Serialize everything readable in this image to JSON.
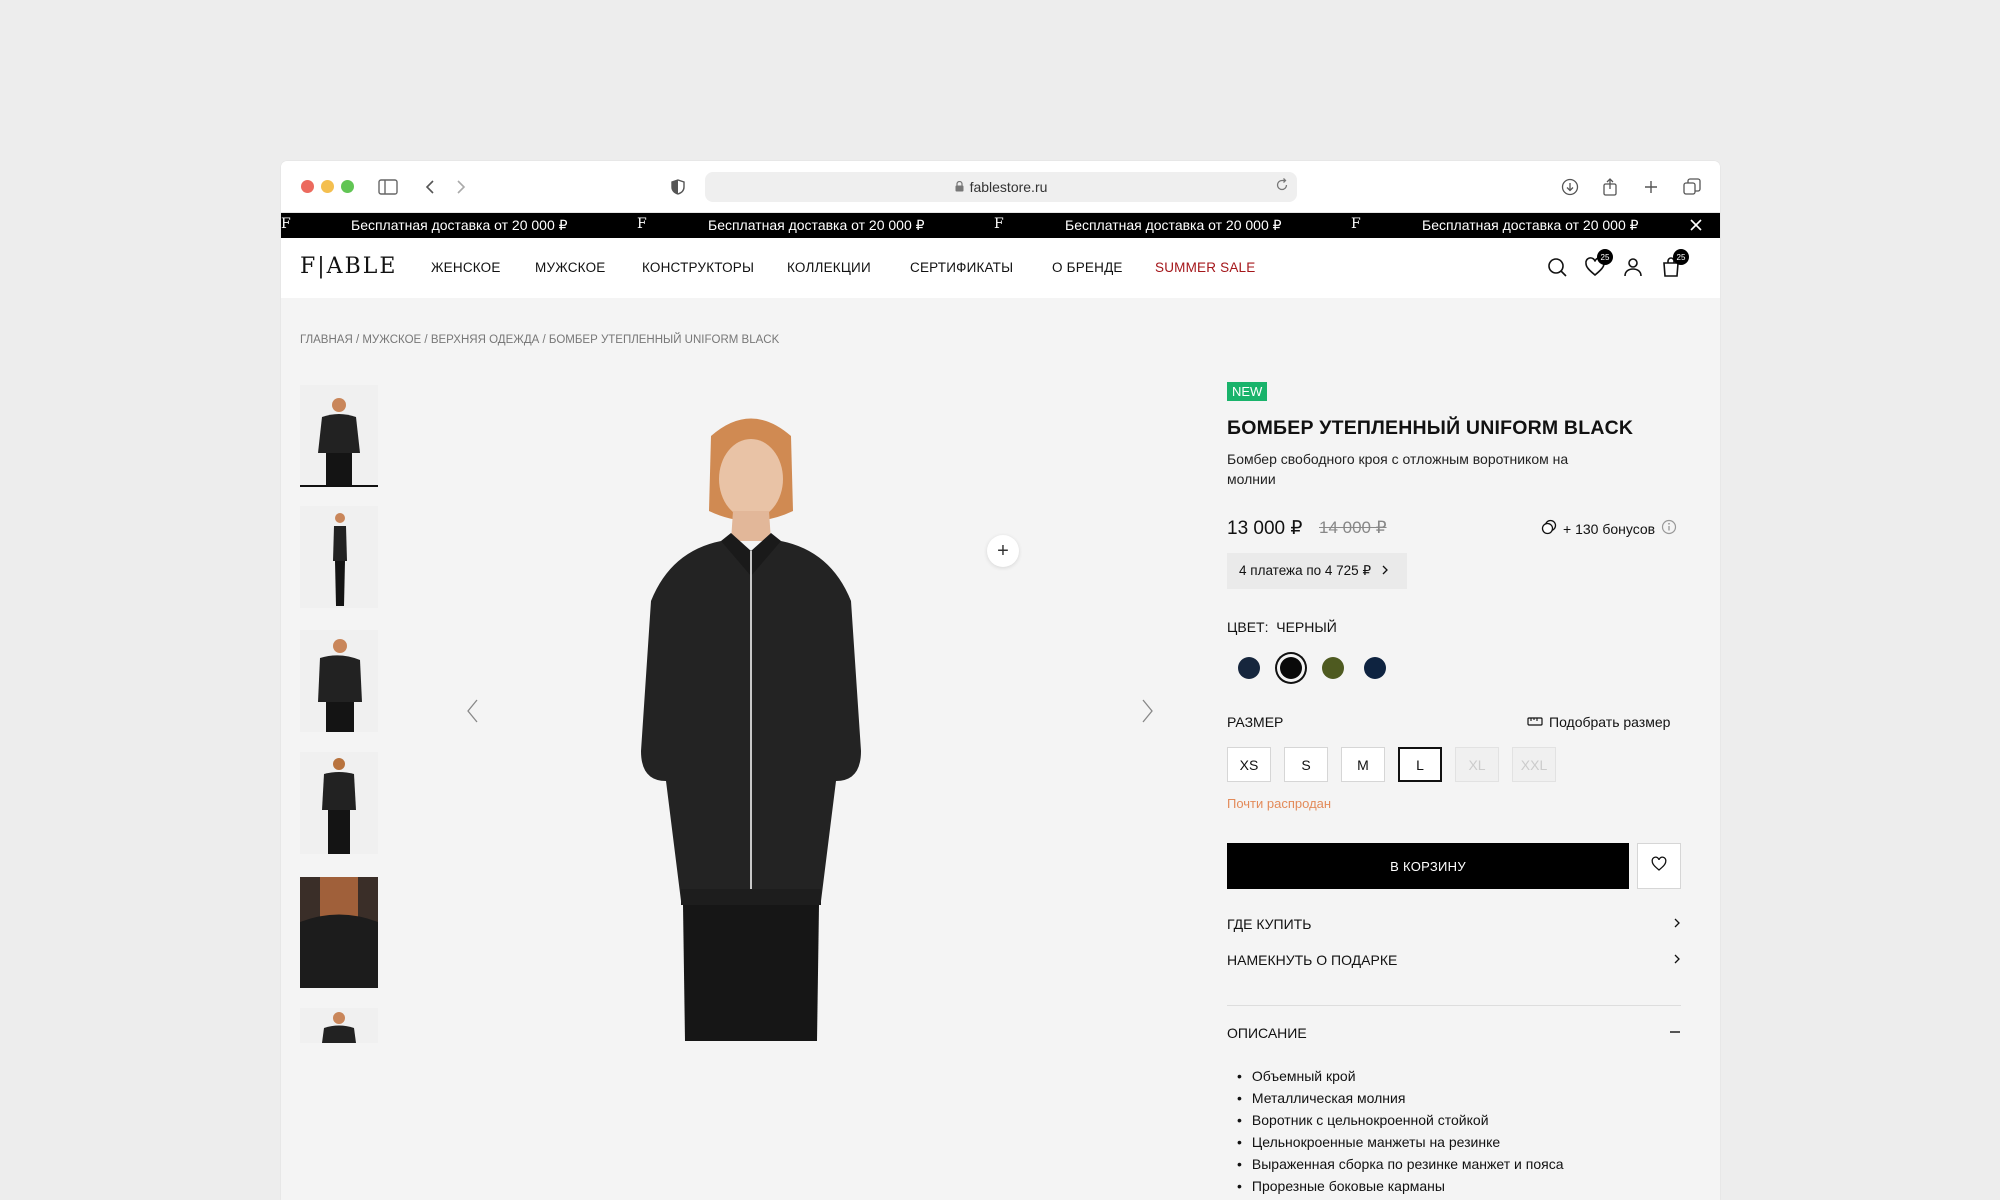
{
  "browser": {
    "url": "fablestore.ru"
  },
  "promo": {
    "brand_mark": "F",
    "text": "Бесплатная доставка от 20 000 ₽"
  },
  "header": {
    "logo": "F|ABLE",
    "nav": [
      "ЖЕНСКОЕ",
      "МУЖСКОЕ",
      "КОНСТРУКТОРЫ",
      "КОЛЛЕКЦИИ",
      "СЕРТИФИКАТЫ",
      "О БРЕНДЕ",
      "SUMMER SALE"
    ],
    "wishlist_count": "25",
    "cart_count": "25"
  },
  "breadcrumbs": [
    "ГЛАВНАЯ",
    "МУЖСКОЕ",
    "ВЕРХНЯЯ ОДЕЖДА",
    "БОМБЕР УТЕПЛЕННЫЙ UNIFORM BLACK"
  ],
  "product": {
    "badge": "NEW",
    "title": "БОМБЕР УТЕПЛЕННЫЙ UNIFORM BLACK",
    "subtitle": "Бомбер свободного кроя с отложным воротником на молнии",
    "price": "13 000 ₽",
    "old_price": "14 000 ₽",
    "bonus": "+ 130 бонусов",
    "installments": "4 платежа по 4 725 ₽",
    "color_label": "ЦВЕТ:",
    "color_value": "ЧЕРНЫЙ",
    "swatches": [
      "#16263d",
      "#0a0a0a",
      "#4e5a20",
      "#0e2340"
    ],
    "selected_swatch": 1,
    "size_label": "РАЗМЕР",
    "size_guide": "Подобрать размер",
    "sizes": [
      "XS",
      "S",
      "M",
      "L",
      "XL",
      "XXL"
    ],
    "selected_size": "L",
    "unavailable_sizes": [
      "XL",
      "XXL"
    ],
    "stock_note": "Почти распродан",
    "add_to_cart": "В КОРЗИНУ",
    "where_to_buy": "ГДЕ КУПИТЬ",
    "gift_hint": "НАМЕКНУТЬ О ПОДАРКЕ",
    "description_title": "ОПИСАНИЕ",
    "description": [
      "Объемный крой",
      "Металлическая молния",
      "Воротник с цельнокроенной стойкой",
      "Цельнокроенные манжеты на резинке",
      "Выраженная сборка по резинке манжет и пояса",
      "Прорезные боковые карманы"
    ]
  },
  "colors": {
    "new_badge": "#19b36b",
    "sale": "#a4161a",
    "stock_note": "#e38b5a"
  }
}
